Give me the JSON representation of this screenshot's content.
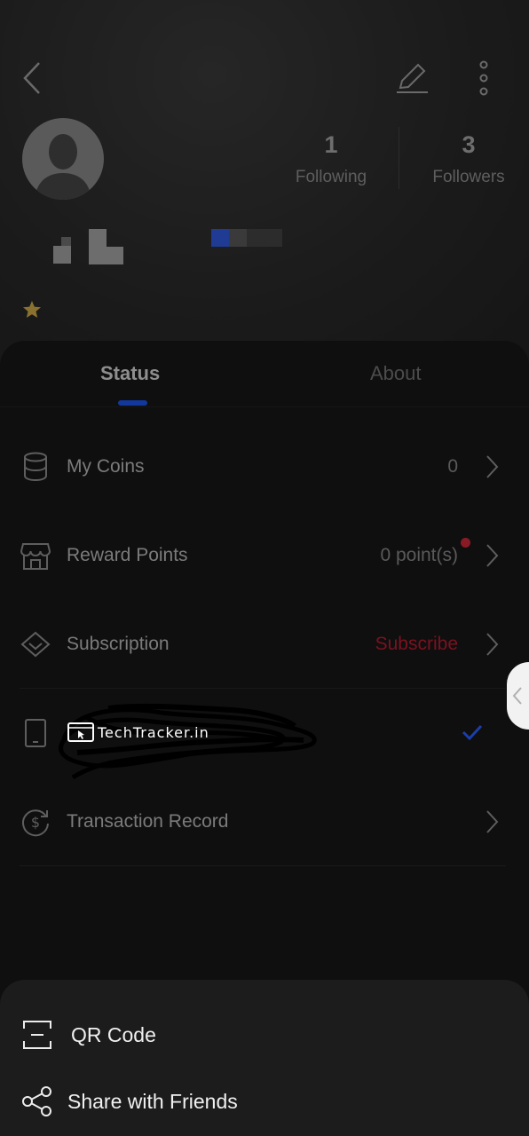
{
  "profile": {
    "following": {
      "count": "1",
      "label": "Following"
    },
    "followers": {
      "count": "3",
      "label": "Followers"
    }
  },
  "tabs": [
    {
      "label": "Status",
      "active": true
    },
    {
      "label": "About",
      "active": false
    }
  ],
  "status_list": [
    {
      "icon": "coins-icon",
      "label": "My Coins",
      "value": "0"
    },
    {
      "icon": "store-icon",
      "label": "Reward Points",
      "value": "0 point(s)",
      "badge": true
    },
    {
      "icon": "diamond-icon",
      "label": "Subscription",
      "value": "Subscribe",
      "value_color": "#7a1220"
    },
    {
      "icon": "phone-icon",
      "label": "",
      "checked": true
    },
    {
      "icon": "dollar-refresh-icon",
      "label": "Transaction Record",
      "value": ""
    }
  ],
  "watermark": "TechTracker.in",
  "bottom_sheet": [
    {
      "icon": "qr-code-icon",
      "label": "QR Code"
    },
    {
      "icon": "share-icon",
      "label": "Share with Friends"
    }
  ],
  "colors": {
    "accent": "#12389b",
    "alert": "#8a1a25",
    "check": "#1b3ea8"
  }
}
